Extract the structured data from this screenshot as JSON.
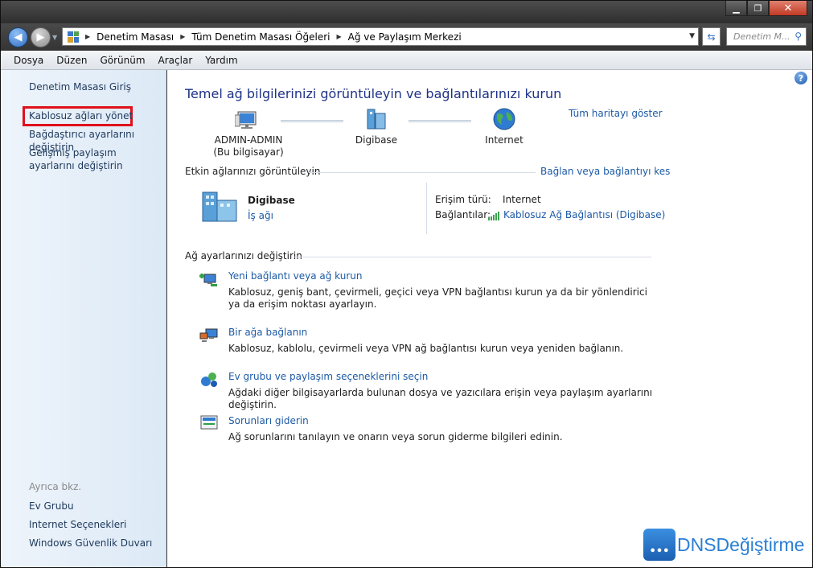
{
  "window": {
    "min": "▁",
    "max": "❐",
    "close": "✕"
  },
  "address": {
    "crumbs": [
      "Denetim Masası",
      "Tüm Denetim Masası Öğeleri",
      "Ağ ve Paylaşım Merkezi"
    ],
    "search_placeholder": "Denetim M..."
  },
  "menu": [
    "Dosya",
    "Düzen",
    "Görünüm",
    "Araçlar",
    "Yardım"
  ],
  "sidebar": {
    "home": "Denetim Masası Giriş",
    "items": [
      "Kablosuz ağları yönet",
      "Bağdaştırıcı ayarlarını değiştirin",
      "Gelişmiş paylaşım ayarlarını değiştirin"
    ],
    "see_also_title": "Ayrıca bkz.",
    "see_also": [
      "Ev Grubu",
      "Internet Seçenekleri",
      "Windows Güvenlik Duvarı"
    ]
  },
  "main": {
    "title": "Temel ağ bilgilerinizi görüntüleyin ve bağlantılarınızı kurun",
    "full_map": "Tüm haritayı göster",
    "map_nodes": [
      {
        "label": "ADMIN-ADMIN",
        "sub": "(Bu bilgisayar)"
      },
      {
        "label": "Digibase",
        "sub": ""
      },
      {
        "label": "Internet",
        "sub": ""
      }
    ],
    "active_title": "Etkin ağlarınızı görüntüleyin",
    "connect_link": "Bağlan veya bağlantıyı kes",
    "network": {
      "name": "Digibase",
      "type": "İş ağı",
      "access_label": "Erişim türü:",
      "access_value": "Internet",
      "connections_label": "Bağlantılar:",
      "connections_value": "Kablosuz Ağ Bağlantısı (Digibase)"
    },
    "change_title": "Ağ ayarlarınızı değiştirin",
    "tasks": [
      {
        "title": "Yeni bağlantı veya ağ kurun",
        "desc": "Kablosuz, geniş bant, çevirmeli, geçici veya VPN bağlantısı kurun ya da bir yönlendirici ya da erişim noktası ayarlayın."
      },
      {
        "title": "Bir ağa bağlanın",
        "desc": "Kablosuz, kablolu, çevirmeli veya VPN ağ bağlantısı kurun veya yeniden bağlanın."
      },
      {
        "title": "Ev grubu ve paylaşım seçeneklerini seçin",
        "desc": "Ağdaki diğer bilgisayarlarda bulunan dosya ve yazıcılara erişin veya paylaşım ayarlarını değiştirin."
      },
      {
        "title": "Sorunları giderin",
        "desc": "Ağ sorunlarını tanılayın ve onarın veya sorun giderme bilgileri edinin."
      }
    ]
  },
  "watermark": {
    "text": "DNSDeğiştirme"
  }
}
